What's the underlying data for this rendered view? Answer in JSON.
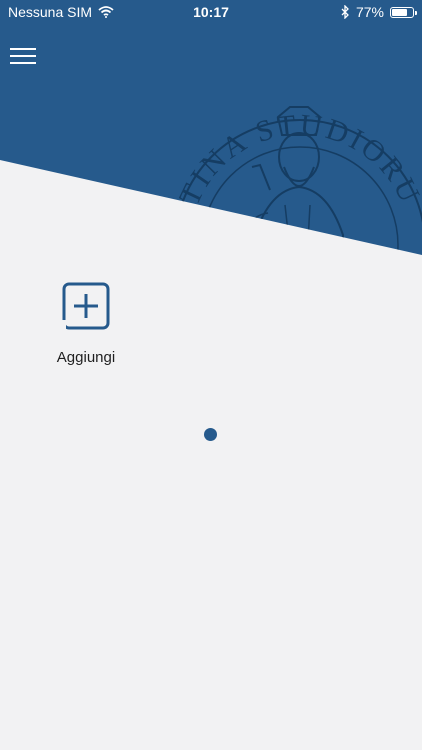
{
  "status_bar": {
    "carrier": "Nessuna SIM",
    "time": "10:17",
    "battery_percent": "77%",
    "battery_level": 0.77,
    "icons": [
      "wifi-icon",
      "bluetooth-icon",
      "battery-icon"
    ]
  },
  "header": {
    "menu_icon": "hamburger-menu-icon",
    "seal_text": "NTINA STUDIORU",
    "background_color": "#265a8c"
  },
  "main": {
    "add_tile": {
      "label": "Aggiungi",
      "icon": "add-square-icon"
    },
    "background_color": "#f2f2f3"
  }
}
